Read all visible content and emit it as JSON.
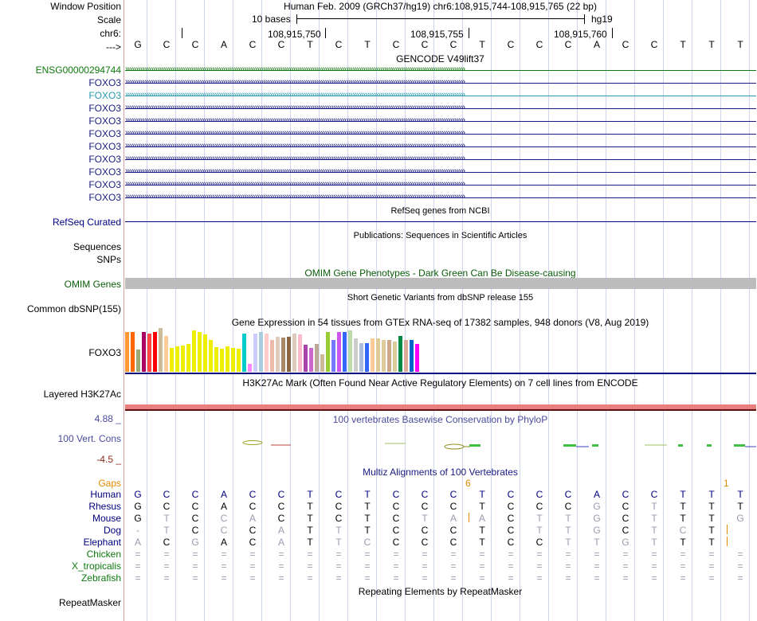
{
  "header": {
    "window_position_label": "Window Position",
    "scale_label": "Scale",
    "chrom_label": "chr6:",
    "strand_label": "--->",
    "assembly_title": "Human Feb. 2009 (GRCh37/hg19)   chr6:108,915,744-108,915,765 (22 bp)",
    "scale_text": "10 bases",
    "assembly": "hg19",
    "coordinates": [
      "108,915,750",
      "108,915,755",
      "108,915,760"
    ]
  },
  "sequence": [
    "G",
    "C",
    "C",
    "A",
    "C",
    "C",
    "T",
    "C",
    "T",
    "C",
    "C",
    "C",
    "T",
    "C",
    "C",
    "C",
    "A",
    "C",
    "C",
    "T",
    "T",
    "T"
  ],
  "tracks": {
    "gencode_title": "GENCODE V49lift37",
    "gencode_labels": [
      "ENSG00000294744",
      "FOXO3",
      "FOXO3",
      "FOXO3",
      "FOXO3",
      "FOXO3",
      "FOXO3",
      "FOXO3",
      "FOXO3",
      "FOXO3",
      "FOXO3"
    ],
    "refseq_title": "RefSeq genes from NCBI",
    "refseq_label": "RefSeq Curated",
    "publications_title": "Publications: Sequences in Scientific Articles",
    "publications_label": "Sequences",
    "snps_label": "SNPs",
    "omim_title": "OMIM Gene Phenotypes - Dark Green Can Be Disease-causing",
    "omim_label": "OMIM Genes",
    "dbsnp_title": "Short Genetic Variants from dbSNP release 155",
    "dbsnp_label": "Common dbSNP(155)",
    "gtex_title": "Gene Expression in 54 tissues from GTEx RNA-seq of 17382 samples, 948 donors (V8, Aug 2019)",
    "gtex_label": "FOXO3",
    "h3k27ac_title": "H3K27Ac Mark (Often Found Near Active Regulatory Elements) on 7 cell lines from ENCODE",
    "h3k27ac_label": "Layered H3K27Ac",
    "cons_title": "100 vertebrates Basewise Conservation by PhyloP",
    "cons_label": "100 Vert. Cons",
    "cons_max": "4.88 _",
    "cons_min": "-4.5 _",
    "multiz_title": "Multiz Alignments of 100 Vertebrates",
    "repeat_title": "Repeating Elements by RepeatMasker",
    "repeat_label": "RepeatMasker"
  },
  "gaps": {
    "label": "Gaps",
    "values": [
      "6",
      "1"
    ]
  },
  "alignments": [
    {
      "species": "Human",
      "bases": [
        "G",
        "C",
        "C",
        "A",
        "C",
        "C",
        "T",
        "C",
        "T",
        "C",
        "C",
        "C",
        "T",
        "C",
        "C",
        "C",
        "A",
        "C",
        "C",
        "T",
        "T",
        "T"
      ]
    },
    {
      "species": "Rhesus",
      "bases": [
        "G",
        "C",
        "C",
        "A",
        "C",
        "C",
        "T",
        "C",
        "T",
        "C",
        "C",
        "C",
        "T",
        "C",
        "C",
        "C",
        "G",
        "C",
        "T",
        "T",
        "T",
        "T"
      ]
    },
    {
      "species": "Mouse",
      "bases": [
        "G",
        "T",
        "C",
        "C",
        "A",
        "C",
        "T",
        "C",
        "T",
        "C",
        "T",
        "A",
        "A",
        "C",
        "T",
        "T",
        "G",
        "C",
        "T",
        "T",
        "T",
        "G"
      ]
    },
    {
      "species": "Dog",
      "bases": [
        "-",
        "T",
        "C",
        "C",
        "C",
        "A",
        "T",
        "T",
        "T",
        "C",
        "C",
        "C",
        "T",
        "C",
        "T",
        "T",
        "G",
        "C",
        "T",
        "C",
        "T",
        ""
      ]
    },
    {
      "species": "Elephant",
      "bases": [
        "A",
        "C",
        "G",
        "A",
        "C",
        "A",
        "T",
        "T",
        "C",
        "C",
        "C",
        "C",
        "T",
        "C",
        "C",
        "T",
        "T",
        "G",
        "T",
        "T",
        "T",
        ""
      ]
    },
    {
      "species": "Chicken",
      "bases": [
        "=",
        "=",
        "=",
        "=",
        "=",
        "=",
        "=",
        "=",
        "=",
        "=",
        "=",
        "=",
        "=",
        "=",
        "=",
        "=",
        "=",
        "=",
        "=",
        "=",
        "=",
        "="
      ]
    },
    {
      "species": "X_tropicalis",
      "bases": [
        "=",
        "=",
        "=",
        "=",
        "=",
        "=",
        "=",
        "=",
        "=",
        "=",
        "=",
        "=",
        "=",
        "=",
        "=",
        "=",
        "=",
        "=",
        "=",
        "=",
        "=",
        "="
      ]
    },
    {
      "species": "Zebrafish",
      "bases": [
        "=",
        "=",
        "=",
        "=",
        "=",
        "=",
        "=",
        "=",
        "=",
        "=",
        "=",
        "=",
        "=",
        "=",
        "=",
        "=",
        "=",
        "=",
        "=",
        "=",
        "=",
        "="
      ]
    }
  ],
  "gtex_values": [
    50,
    50,
    28,
    50,
    48,
    50,
    55,
    45,
    30,
    32,
    33,
    35,
    52,
    50,
    47,
    40,
    31,
    29,
    32,
    30,
    29,
    48,
    10,
    48,
    50,
    48,
    40,
    44,
    43,
    44,
    48,
    47,
    34,
    30,
    35,
    22,
    50,
    40,
    50,
    50,
    52,
    42,
    36,
    36,
    42,
    42,
    40,
    40,
    38,
    45,
    40,
    40,
    35
  ],
  "gtex_colors": [
    "#ff9933",
    "#ff6600",
    "#99aa77",
    "#aa0066",
    "#ff4444",
    "#ff0000",
    "#ccbb99",
    "#ffcc99",
    "#eeee00",
    "#eeee00",
    "#eeee00",
    "#eeee00",
    "#eeee00",
    "#eeee00",
    "#eeee00",
    "#eeee00",
    "#eeee00",
    "#eeee00",
    "#eeee00",
    "#eeee00",
    "#eeee00",
    "#00cccc",
    "#ff88ff",
    "#ccccff",
    "#aaccdd",
    "#ffcccc",
    "#eebbaa",
    "#ddccbb",
    "#aa8866",
    "#886644",
    "#ddccbb",
    "#ffbbcc",
    "#aa44aa",
    "#cc66cc",
    "#bbaa99",
    "#ccbb99",
    "#99cc33",
    "#7777ff",
    "#cc55ee",
    "#3366ff",
    "#bbddaa",
    "#cccccc",
    "#aabbdd",
    "#3366ff",
    "#ffcc99",
    "#ddcc99",
    "#ddcc99",
    "#ccaa88",
    "#ddcc99",
    "#008844",
    "#ddaa99",
    "#0066cc",
    "#ff00ff"
  ],
  "colors": {
    "label_navy": "#000080",
    "gencode_green": "#0d7a0d",
    "gencode_blue": "#1a1a80",
    "gencode_teal": "#2a9aac",
    "omim_gray": "#bcbcbc",
    "omim_green": "#0a5c0a",
    "h3k27ac_red": "#e88080",
    "cons_navy": "#4a4a9e",
    "gaps_orange": "#e08a00"
  }
}
